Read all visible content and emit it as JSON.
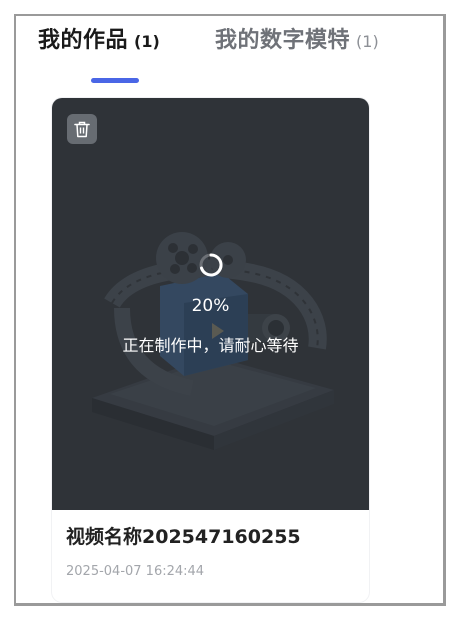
{
  "tabs": [
    {
      "label": "我的作品",
      "count": "(1)",
      "active": true
    },
    {
      "label": "我的数字模特",
      "count": "(1)",
      "active": false
    }
  ],
  "colors": {
    "accent": "#4a66e6",
    "thumbnail_overlay": "#2f3338",
    "title_text": "#222222",
    "muted_text": "#a3a6ab"
  },
  "video_card": {
    "progress_percent": 20,
    "progress_label": "20%",
    "status": "正在制作中，请耐心等待",
    "title": "视频名称202547160255",
    "date": "2025-04-07 16:24:44",
    "delete_icon": "trash-icon",
    "thumbnail_icon": "film-camera-illustration"
  }
}
